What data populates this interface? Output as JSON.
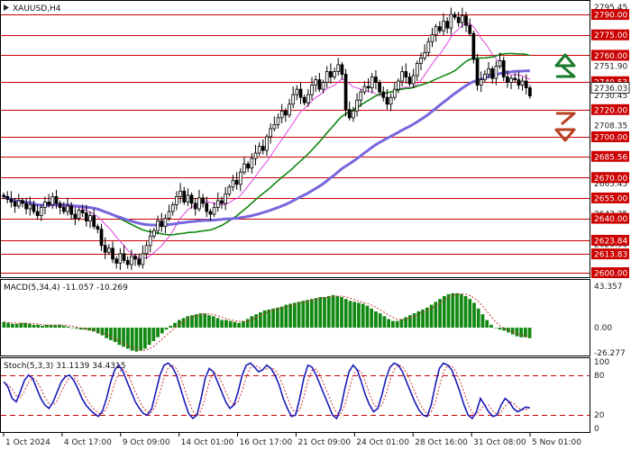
{
  "chart_data": [
    {
      "type": "candlestick",
      "title": "XAUUSD,H4",
      "ylim": [
        2598,
        2798
      ],
      "price_ticks": [
        "2795.45",
        "2775.00",
        "2751.90",
        "2730.45",
        "2708.35",
        "2685.56",
        "2665.45",
        "2643.35",
        "2620.90",
        "2600.00"
      ],
      "levels": [
        {
          "label": "2790.00",
          "value": 2790
        },
        {
          "label": "2775.00",
          "value": 2775
        },
        {
          "label": "2760.00",
          "value": 2760
        },
        {
          "label": "2740.53",
          "value": 2740.53
        },
        {
          "label": "2720.00",
          "value": 2720
        },
        {
          "label": "2700.00",
          "value": 2700
        },
        {
          "label": "2685.56",
          "value": 2685.56
        },
        {
          "label": "2670.00",
          "value": 2670
        },
        {
          "label": "2655.00",
          "value": 2655
        },
        {
          "label": "2640.00",
          "value": 2640
        },
        {
          "label": "2623.84",
          "value": 2623.84
        },
        {
          "label": "2613.83",
          "value": 2613.83
        },
        {
          "label": "2600.00",
          "value": 2600
        }
      ],
      "current_price": {
        "label": "2736.03",
        "value": 2736.03
      },
      "colors": {
        "levels": "#cc0000",
        "ma_fast": "#e040e0",
        "ma_mid": "#118811",
        "ma_slow": "#7766dd",
        "candle": "#000000",
        "arrow_up": "#1a7a2a",
        "arrow_down": "#b84020"
      },
      "closes": [
        2656,
        2654,
        2652,
        2649,
        2653,
        2651,
        2647,
        2650,
        2645,
        2642,
        2648,
        2652,
        2650,
        2656,
        2651,
        2648,
        2645,
        2649,
        2643,
        2640,
        2646,
        2644,
        2638,
        2642,
        2634,
        2632,
        2620,
        2615,
        2618,
        2610,
        2607,
        2614,
        2609,
        2606,
        2612,
        2610,
        2606,
        2614,
        2620,
        2627,
        2631,
        2638,
        2634,
        2640,
        2645,
        2650,
        2656,
        2660,
        2652,
        2657,
        2651,
        2647,
        2655,
        2651,
        2645,
        2643,
        2648,
        2653,
        2651,
        2658,
        2663,
        2668,
        2665,
        2674,
        2680,
        2677,
        2684,
        2688,
        2693,
        2690,
        2700,
        2706,
        2709,
        2714,
        2719,
        2716,
        2724,
        2731,
        2735,
        2729,
        2725,
        2731,
        2738,
        2742,
        2735,
        2740,
        2748,
        2744,
        2748,
        2753,
        2746,
        2720,
        2714,
        2719,
        2727,
        2733,
        2737,
        2736,
        2744,
        2740,
        2733,
        2729,
        2724,
        2729,
        2735,
        2741,
        2748,
        2744,
        2739,
        2745,
        2754,
        2758,
        2762,
        2770,
        2775,
        2781,
        2778,
        2785,
        2780,
        2790,
        2788,
        2784,
        2789,
        2782,
        2776,
        2757,
        2738,
        2742,
        2746,
        2750,
        2743,
        2752,
        2756,
        2744,
        2740,
        2743,
        2742,
        2738,
        2741,
        2736,
        2730
      ]
    },
    {
      "type": "bar",
      "title": "MACD(5,34,4) -11.057 -10.269",
      "ylim": [
        -26.277,
        43.357
      ],
      "y_ticks": [
        "43.357",
        "0.00",
        "-26.277"
      ],
      "colors": {
        "bars": "#118811",
        "signal": "#cc3333"
      },
      "values": [
        6,
        5,
        4,
        4,
        5,
        5,
        4,
        3,
        3,
        2,
        3,
        3,
        3,
        3,
        2,
        1,
        0,
        -1,
        -2,
        -2,
        -3,
        -4,
        -6,
        -8,
        -11,
        -13,
        -15,
        -18,
        -20,
        -22,
        -24,
        -25,
        -24,
        -22,
        -18,
        -14,
        -10,
        -6,
        -2,
        2,
        5,
        8,
        10,
        12,
        13,
        14,
        15,
        15,
        13,
        12,
        10,
        8,
        8,
        7,
        6,
        5,
        7,
        9,
        12,
        14,
        16,
        18,
        19,
        20,
        21,
        22,
        24,
        25,
        26,
        27,
        28,
        29,
        30,
        31,
        32,
        32,
        33,
        34,
        33,
        32,
        30,
        28,
        27,
        26,
        25,
        23,
        20,
        17,
        15,
        12,
        9,
        7,
        7,
        9,
        11,
        13,
        15,
        17,
        19,
        21,
        24,
        27,
        30,
        33,
        35,
        36,
        36,
        35,
        33,
        30,
        26,
        20,
        14,
        8,
        3,
        0,
        -2,
        -3,
        -5,
        -7,
        -9,
        -10,
        -10,
        -11
      ]
    },
    {
      "type": "line",
      "title": "Stoch(5,3,3) 31.1139 34.4315",
      "ylim": [
        0,
        100
      ],
      "y_ticks": [
        "100",
        "80",
        "20",
        "0"
      ],
      "levels": [
        80,
        20
      ],
      "colors": {
        "main": "#1a1ab8",
        "signal": "#cc3333",
        "levels": "#cc0000"
      },
      "values": [
        70,
        62,
        45,
        40,
        55,
        72,
        80,
        75,
        60,
        45,
        35,
        30,
        40,
        55,
        70,
        78,
        80,
        72,
        60,
        45,
        35,
        28,
        22,
        18,
        26,
        45,
        70,
        88,
        95,
        85,
        70,
        55,
        40,
        30,
        22,
        20,
        30,
        55,
        80,
        95,
        98,
        92,
        80,
        60,
        40,
        22,
        15,
        20,
        45,
        75,
        90,
        85,
        70,
        55,
        40,
        30,
        35,
        55,
        80,
        95,
        98,
        92,
        85,
        88,
        95,
        90,
        80,
        65,
        45,
        30,
        18,
        20,
        45,
        75,
        95,
        92,
        80,
        65,
        50,
        35,
        20,
        15,
        30,
        60,
        85,
        95,
        88,
        70,
        50,
        35,
        25,
        30,
        50,
        75,
        92,
        98,
        95,
        85,
        70,
        55,
        40,
        28,
        20,
        18,
        35,
        65,
        90,
        98,
        95,
        88,
        72,
        55,
        35,
        20,
        15,
        25,
        45,
        35,
        25,
        18,
        20,
        35,
        45,
        40,
        30,
        25,
        28,
        32,
        31
      ]
    }
  ],
  "x_ticks": [
    "1 Oct 2024",
    "4 Oct 17:00",
    "9 Oct 09:00",
    "14 Oct 01:00",
    "16 Oct 17:00",
    "21 Oct 09:00",
    "24 Oct 01:00",
    "28 Oct 16:00",
    "31 Oct 08:00",
    "5 Nov 01:00"
  ]
}
